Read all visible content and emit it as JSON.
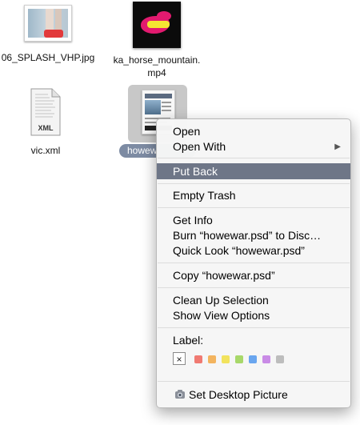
{
  "desktop": {
    "files": [
      {
        "name": "06_SPLASH_VHP.jpg"
      },
      {
        "name_line1": "ka_horse_mountain.",
        "name_line2": "mp4"
      },
      {
        "name": "vic.xml",
        "badge": "XML"
      },
      {
        "name": "howew",
        "selected": true
      }
    ]
  },
  "menu": {
    "open": "Open",
    "open_with": "Open With",
    "put_back": "Put Back",
    "empty_trash": "Empty Trash",
    "get_info": "Get Info",
    "burn": "Burn “howewar.psd” to Disc…",
    "quick_look": "Quick Look “howewar.psd”",
    "copy": "Copy “howewar.psd”",
    "clean_up": "Clean Up Selection",
    "view_options": "Show View Options",
    "label_heading": "Label:",
    "label_none": "×",
    "label_colors": [
      "#f07a72",
      "#f3b45f",
      "#f2e35d",
      "#a8d86a",
      "#6aa6ef",
      "#c98be6",
      "#bdbdbd"
    ],
    "set_desktop": "Set Desktop Picture"
  },
  "icons": {
    "submenu": "triangle-right",
    "desktop_picture": "camera"
  }
}
